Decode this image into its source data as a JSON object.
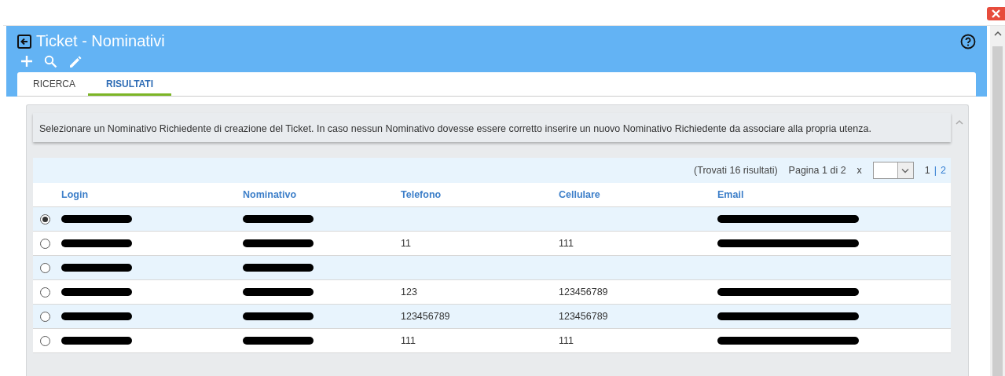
{
  "window": {
    "title": "Ticket - Nominativi"
  },
  "toolbar": [
    {
      "kind": "add"
    },
    {
      "kind": "search"
    },
    {
      "kind": "edit"
    }
  ],
  "tabs": [
    {
      "label": "RICERCA",
      "selected": false
    },
    {
      "label": "RISULTATI",
      "selected": true
    }
  ],
  "info": "Selezionare un Nominativo Richiedente di creazione del Ticket. In caso nessun Nominativo dovesse essere corretto inserire un nuovo Nominativo Richiedente da associare alla propria utenza.",
  "pager": {
    "found": "(Trovati 16 risultati)",
    "page": "Pagina 1 di 2",
    "per_page_label": "x",
    "pages": [
      {
        "label": "1",
        "selected": true
      },
      {
        "label": "2",
        "selected": false
      }
    ],
    "separator": "|"
  },
  "table": {
    "columns": [
      "Login",
      "Nominativo",
      "Telefono",
      "Cellulare",
      "Email"
    ],
    "rows": [
      {
        "selected": true,
        "cells": [
          {
            "kind": "redacted"
          },
          {
            "kind": "redacted"
          },
          null,
          null,
          {
            "kind": "redacted"
          }
        ]
      },
      {
        "selected": false,
        "cells": [
          {
            "kind": "redacted"
          },
          {
            "kind": "redacted"
          },
          {
            "kind": "text",
            "text": "11"
          },
          {
            "kind": "text",
            "text": "111"
          },
          {
            "kind": "redacted"
          }
        ]
      },
      {
        "selected": false,
        "cells": [
          {
            "kind": "redacted"
          },
          {
            "kind": "redacted"
          },
          null,
          null,
          null
        ]
      },
      {
        "selected": false,
        "cells": [
          {
            "kind": "redacted"
          },
          {
            "kind": "redacted"
          },
          {
            "kind": "text",
            "text": "123"
          },
          {
            "kind": "text",
            "text": "123456789"
          },
          {
            "kind": "redacted"
          }
        ]
      },
      {
        "selected": false,
        "cells": [
          {
            "kind": "redacted"
          },
          {
            "kind": "redacted"
          },
          {
            "kind": "text",
            "text": "123456789"
          },
          {
            "kind": "text",
            "text": "123456789"
          },
          {
            "kind": "redacted"
          }
        ]
      },
      {
        "selected": false,
        "cells": [
          {
            "kind": "redacted"
          },
          {
            "kind": "redacted"
          },
          {
            "kind": "text",
            "text": "111"
          },
          {
            "kind": "text",
            "text": "111"
          },
          {
            "kind": "redacted"
          }
        ]
      }
    ]
  }
}
